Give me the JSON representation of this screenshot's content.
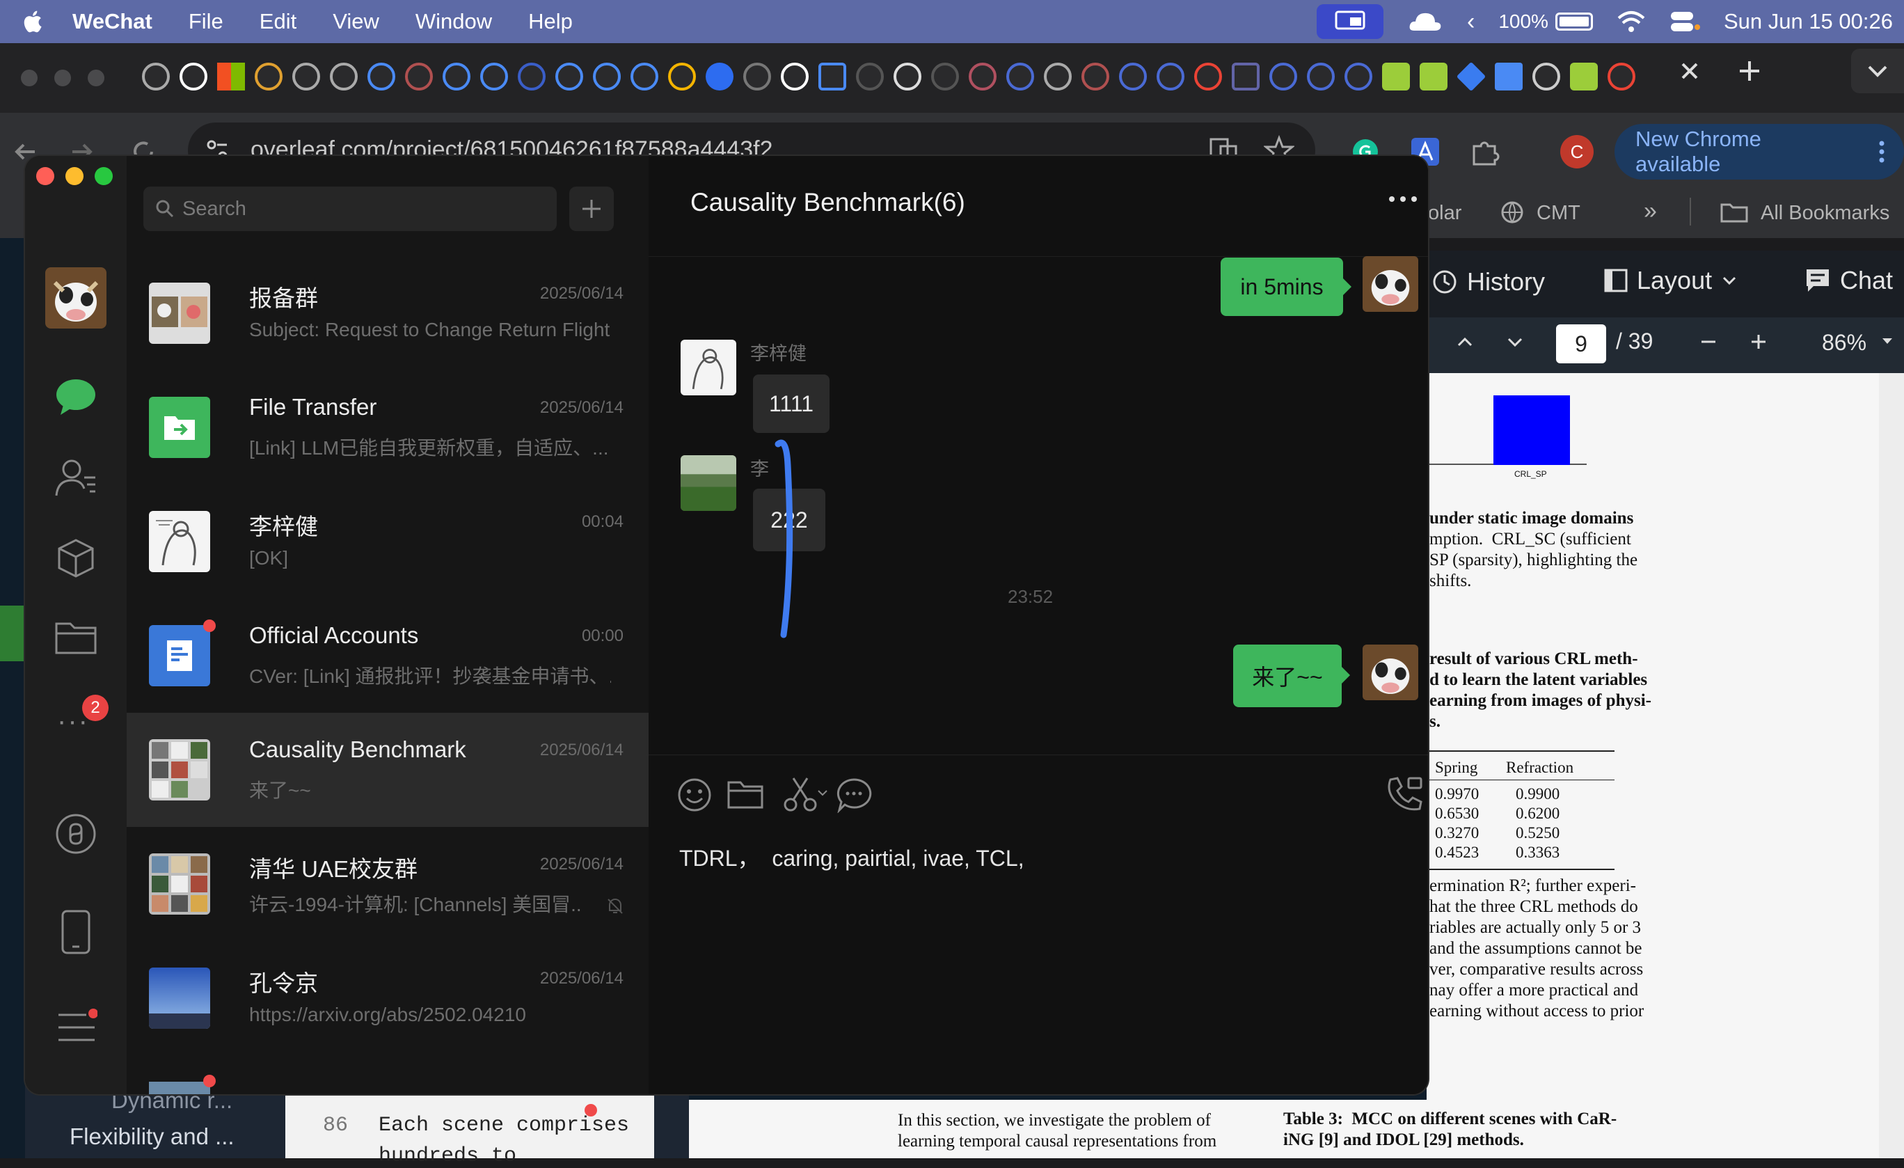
{
  "menubar": {
    "app": "WeChat",
    "items": [
      "File",
      "Edit",
      "View",
      "Window",
      "Help"
    ],
    "battery": "100%",
    "clock": "Sun Jun 15  00:26"
  },
  "chrome": {
    "url": "overleaf.com/project/68150046261f87588a4443f2",
    "new_chrome": "New Chrome available",
    "bookmarks": {
      "scholar": "olar",
      "cmt": "CMT",
      "all": "All Bookmarks"
    }
  },
  "overleaf": {
    "history": "History",
    "layout": "Layout",
    "chat": "Chat",
    "page_current": "9",
    "page_total": "/ 39",
    "zoom": "86%",
    "file_tree": [
      "Dynamic r...",
      "Flexibility and ..."
    ],
    "editor": {
      "line_no": "86",
      "line": "Each scene comprises",
      "line2": "hundreds to"
    },
    "pdf": {
      "bar_label": "CRL_SP",
      "para1": [
        "under static image domains",
        "mption.  CRL_SC (sufficient",
        "SP (sparsity), highlighting the",
        "shifts."
      ],
      "caption": [
        "result of various CRL meth-",
        "d to learn the latent variables",
        "earning from images of physi-",
        "s."
      ],
      "table_headers": [
        "Spring",
        "Refraction"
      ],
      "table_rows": [
        [
          "0.9970",
          "0.9900"
        ],
        [
          "0.6530",
          "0.6200"
        ],
        [
          "0.3270",
          "0.5250"
        ],
        [
          "0.4523",
          "0.3363"
        ]
      ],
      "para2": [
        "ermination R²; further experi-",
        "hat the three CRL methods do",
        "riables are actually only 5 or 3",
        "and the assumptions cannot be",
        "ver, comparative results across",
        "nay offer a more practical and",
        "earning without access to prior"
      ],
      "bottom_left": [
        "In this section, we investigate the problem of",
        "learning temporal causal representations from"
      ],
      "bottom_right": [
        "Table 3:  MCC on different scenes with CaR-",
        "iNG [9] and IDOL [29] methods."
      ]
    }
  },
  "wechat": {
    "search_placeholder": "Search",
    "sidebar_badge": "2",
    "conversations": [
      {
        "name": "报备群",
        "date": "2025/06/14",
        "preview": "Subject: Request to Change Return Flight..."
      },
      {
        "name": "File Transfer",
        "date": "2025/06/14",
        "preview": "[Link] LLM已能自我更新权重，自适应、..."
      },
      {
        "name": "李梓健",
        "date": "00:04",
        "preview": "[OK]"
      },
      {
        "name": "Official Accounts",
        "date": "00:00",
        "preview": "CVer: [Link] 通报批评！抄袭基金申请书、..."
      },
      {
        "name": "Causality Benchmark",
        "date": "2025/06/14",
        "preview": "来了~~"
      },
      {
        "name": "清华 UAE校友群",
        "date": "2025/06/14",
        "preview": "许云-1994-计算机: [Channels] 美国冒..."
      },
      {
        "name": "孔令京",
        "date": "2025/06/14",
        "preview": "https://arxiv.org/abs/2502.04210"
      }
    ],
    "chat": {
      "title": "Causality Benchmark(6)",
      "msg_top": "in 5mins",
      "sender1": "李梓健",
      "msg1": "1111",
      "sender2": "李",
      "msg2": "222",
      "time": "23:52",
      "msg_bottom": "来了~~",
      "input": "TDRL，  caring, pairtial, ivae, TCL,"
    }
  },
  "colors": {
    "wechat_green": "#3eb65c",
    "annotation_blue": "#3f7bf0",
    "pdf_bar": "#0000ff"
  }
}
